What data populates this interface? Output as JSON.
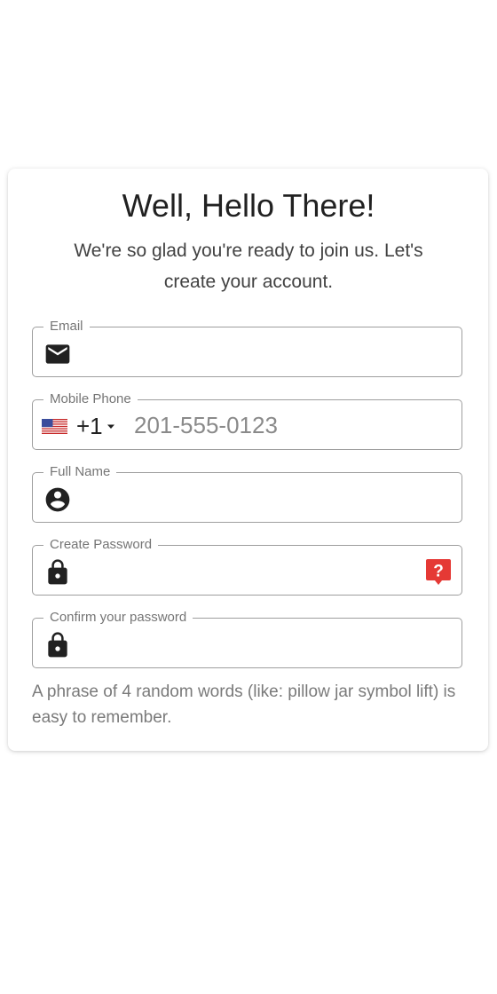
{
  "header": {
    "title": "Well, Hello There!",
    "subtitle": "We're so glad you're ready to join us. Let's create your account."
  },
  "form": {
    "email": {
      "label": "Email",
      "value": "",
      "icon": "mail-icon"
    },
    "phone": {
      "label": "Mobile Phone",
      "country_flag": "us-flag-icon",
      "dial_code": "+1",
      "placeholder": "201-555-0123",
      "value": ""
    },
    "full_name": {
      "label": "Full Name",
      "value": "",
      "icon": "account-circle-icon"
    },
    "password": {
      "label": "Create Password",
      "value": "",
      "icon": "lock-icon",
      "help_icon": "help-icon"
    },
    "confirm_password": {
      "label": "Confirm your password",
      "value": "",
      "icon": "lock-icon"
    },
    "hint": "A phrase of 4 random words (like: pillow jar symbol lift) is easy to remember."
  },
  "colors": {
    "accent_error": "#e53935",
    "text_primary": "#212121",
    "text_secondary": "#757575",
    "border": "#9e9e9e"
  }
}
